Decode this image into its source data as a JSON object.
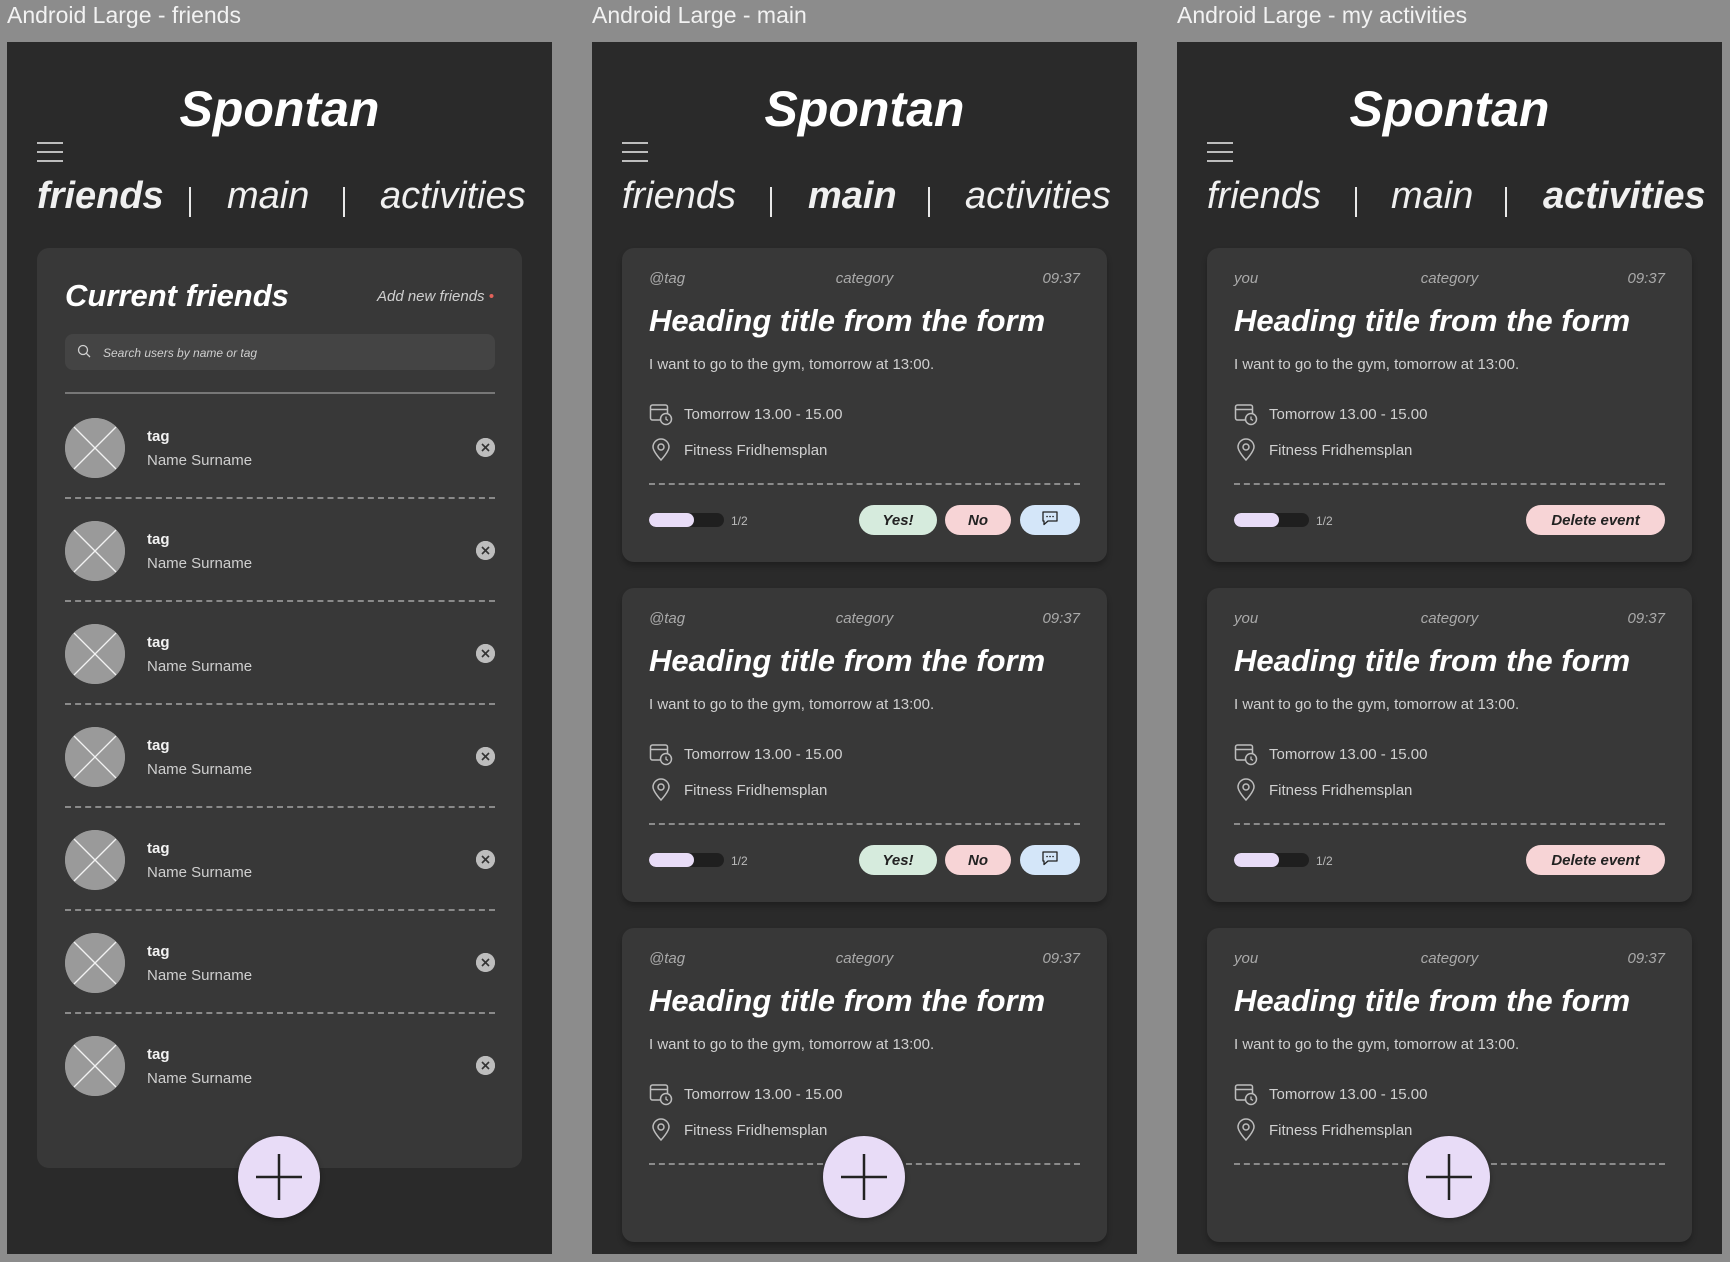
{
  "frames": {
    "friends": {
      "label": "Android Large - friends"
    },
    "main": {
      "label": "Android Large - main"
    },
    "activities": {
      "label": "Android Large - my activities"
    }
  },
  "app": {
    "title": "Spontan"
  },
  "tabs": {
    "friends": "friends",
    "main": "main",
    "activities": "activities"
  },
  "friends_panel": {
    "title": "Current friends",
    "add_label": "Add new friends",
    "add_dot": "•",
    "search_placeholder": "Search users by name or tag",
    "friends": [
      {
        "tag": "tag",
        "name": "Name Surname"
      },
      {
        "tag": "tag",
        "name": "Name Surname"
      },
      {
        "tag": "tag",
        "name": "Name Surname"
      },
      {
        "tag": "tag",
        "name": "Name Surname"
      },
      {
        "tag": "tag",
        "name": "Name Surname"
      },
      {
        "tag": "tag",
        "name": "Name Surname"
      },
      {
        "tag": "tag",
        "name": "Name Surname"
      }
    ]
  },
  "main_cards": [
    {
      "author": "@tag",
      "category": "category",
      "time": "09:37",
      "heading": "Heading title from the form",
      "description": "I want to go to the gym, tomorrow at 13:00.",
      "when": "Tomorrow 13.00 - 15.00",
      "where": "Fitness Fridhemsplan",
      "count": "1/2",
      "fill": 0.6,
      "yes": "Yes!",
      "no": "No"
    },
    {
      "author": "@tag",
      "category": "category",
      "time": "09:37",
      "heading": "Heading title from the form",
      "description": "I want to go to the gym, tomorrow at 13:00.",
      "when": "Tomorrow 13.00 - 15.00",
      "where": "Fitness Fridhemsplan",
      "count": "1/2",
      "fill": 0.6,
      "yes": "Yes!",
      "no": "No"
    },
    {
      "author": "@tag",
      "category": "category",
      "time": "09:37",
      "heading": "Heading title from the form",
      "description": "I want to go to the gym, tomorrow at 13:00.",
      "when": "Tomorrow 13.00 - 15.00",
      "where": "Fitness Fridhemsplan"
    }
  ],
  "activity_cards": [
    {
      "author": "you",
      "category": "category",
      "time": "09:37",
      "heading": "Heading title from the form",
      "description": "I want to go to the gym, tomorrow at 13:00.",
      "when": "Tomorrow 13.00 - 15.00",
      "where": "Fitness Fridhemsplan",
      "count": "1/2",
      "fill": 0.6,
      "delete": "Delete event"
    },
    {
      "author": "you",
      "category": "category",
      "time": "09:37",
      "heading": "Heading title from the form",
      "description": "I want to go to the gym, tomorrow at 13:00.",
      "when": "Tomorrow 13.00 - 15.00",
      "where": "Fitness Fridhemsplan",
      "count": "1/2",
      "fill": 0.6,
      "delete": "Delete event"
    },
    {
      "author": "you",
      "category": "category",
      "time": "09:37",
      "heading": "Heading title from the form",
      "description": "I want to go to the gym, tomorrow at 13:00.",
      "when": "Tomorrow 13.00 - 15.00",
      "where": "Fitness Fridhemsplan"
    }
  ],
  "icons": {
    "menu": "hamburger-menu-icon",
    "search": "search-icon",
    "remove": "close-circle-icon",
    "calendar": "calendar-clock-icon",
    "location": "location-pin-icon",
    "chat": "chat-bubble-icon",
    "add": "plus-icon",
    "avatar": "avatar-placeholder-icon"
  },
  "colors": {
    "background": "#8c8c8c",
    "phone": "#2a2a2a",
    "card": "#383838",
    "accent": "#e8dcf7",
    "yes": "#d6ebdd",
    "no": "#f7d4d6",
    "chat": "#d4e6f9",
    "add_dot": "#e3625a"
  }
}
